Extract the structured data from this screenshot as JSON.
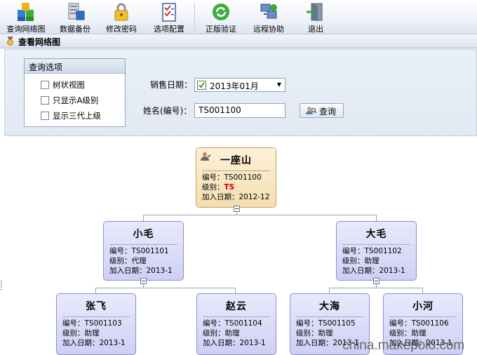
{
  "toolbar": {
    "buttons": [
      {
        "label": "查询网络图",
        "icon": "network-cubes-icon"
      },
      {
        "label": "数据备份",
        "icon": "database-backup-icon"
      },
      {
        "label": "修改密码",
        "icon": "lock-icon"
      },
      {
        "label": "选项配置",
        "icon": "checklist-icon"
      },
      {
        "label": "正版验证",
        "icon": "refresh-arrows-icon"
      },
      {
        "label": "远程协助",
        "icon": "remote-computer-icon"
      },
      {
        "label": "退出",
        "icon": "exit-door-icon"
      }
    ]
  },
  "page": {
    "title": "查看网络图"
  },
  "query": {
    "group_title": "查询选项",
    "options": [
      {
        "label": "树状视图",
        "checked": false
      },
      {
        "label": "只显示A级别",
        "checked": false
      },
      {
        "label": "显示三代上级",
        "checked": false
      }
    ],
    "sale_date_label": "销售日期：",
    "sale_date_value": "2013年01月",
    "sale_date_checked": true,
    "name_label": "姓名(编号)：",
    "name_value": "TS001100",
    "search_label": "查询"
  },
  "tree": {
    "root": {
      "name": "一座山",
      "id_line": "编号：TS001100",
      "level_prefix": "级别：",
      "level": "TS",
      "date_line": "加入日期：2012-12"
    },
    "children": [
      {
        "name": "小毛",
        "id_line": "编号：TS001101",
        "level_line": "级别：代理",
        "date_line": "加入日期：2013-1"
      },
      {
        "name": "大毛",
        "id_line": "编号：TS001102",
        "level_line": "级别：助理",
        "date_line": "加入日期：2013-1"
      }
    ],
    "grandchildren": [
      {
        "name": "张飞",
        "id_line": "编号：TS001103",
        "level_line": "级别：助理",
        "date_line": "加入日期：2013-1"
      },
      {
        "name": "赵云",
        "id_line": "编号：TS001104",
        "level_line": "级别：助理",
        "date_line": "加入日期：2013-1"
      },
      {
        "name": "大海",
        "id_line": "编号：TS001105",
        "level_line": "级别：助理",
        "date_line": "加入日期：2013-1"
      },
      {
        "name": "小河",
        "id_line": "编号：TS001106",
        "level_line": "级别：助理",
        "date_line": "加入日期：2013-1"
      }
    ]
  },
  "watermark": "china.makepolo.com",
  "colors": {
    "root_accent": "#cc0000",
    "node_fill": "#dcdcf8",
    "root_fill": "#f6e4bb"
  }
}
